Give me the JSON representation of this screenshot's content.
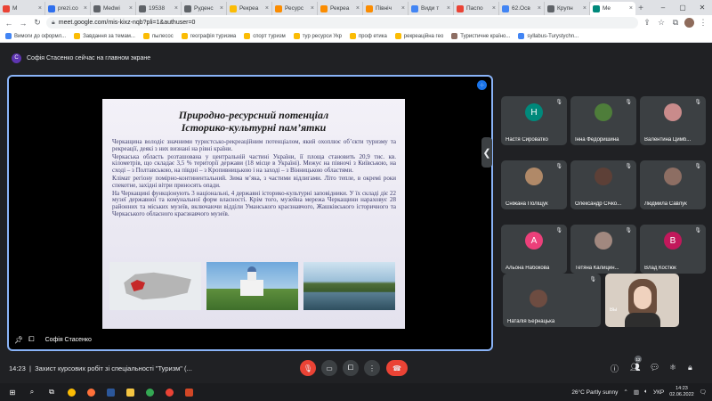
{
  "browser": {
    "tabs": [
      {
        "label": "M",
        "color": "#ea4335"
      },
      {
        "label": "prezi.co",
        "color": "#2f6fed"
      },
      {
        "label": "Medwi",
        "color": "#5f6368"
      },
      {
        "label": "19538",
        "color": "#5f6368"
      },
      {
        "label": "Руденс",
        "color": "#5f6368"
      },
      {
        "label": "Рекреа",
        "color": "#fbbc04"
      },
      {
        "label": "Ресурс",
        "color": "#fb8c00"
      },
      {
        "label": "Рекреа",
        "color": "#fb8c00"
      },
      {
        "label": "Північ",
        "color": "#fb8c00"
      },
      {
        "label": "Види т",
        "color": "#4285f4"
      },
      {
        "label": "Паспо",
        "color": "#ea4335"
      },
      {
        "label": "62.Осв",
        "color": "#4285f4"
      },
      {
        "label": "Крупн",
        "color": "#5f6368"
      },
      {
        "label": "Me",
        "color": "#00897b",
        "active": true
      }
    ],
    "url": "meet.google.com/mis-kixz-nqb?pli=1&authuser=0",
    "bookmarks": [
      {
        "label": "Вимоги до оформл...",
        "color": "#4285f4"
      },
      {
        "label": "Завдання за темам...",
        "color": "#fbbc04"
      },
      {
        "label": "пылесос",
        "color": "#fbbc04"
      },
      {
        "label": "географія туризма",
        "color": "#fbbc04"
      },
      {
        "label": "спорт туризм",
        "color": "#fbbc04"
      },
      {
        "label": "тур ресурси Укр",
        "color": "#fbbc04"
      },
      {
        "label": "проф етика",
        "color": "#fbbc04"
      },
      {
        "label": "рекреаційна гео",
        "color": "#fbbc04"
      },
      {
        "label": "Туристичне країно...",
        "color": "#8d6e63"
      },
      {
        "label": "syllabus-Turystychn...",
        "color": "#4285f4"
      }
    ]
  },
  "meet": {
    "presenting_initial": "С",
    "presenting_text": "Софія Стасенко сейчас на главном экране",
    "presenter_name": "Софія Стасенко",
    "slide": {
      "title_line1": "Природно-ресурсний потенціал",
      "title_line2": "Історико-культурні пам’ятки",
      "para1": "Черкащина володіє значними туристсько-рекреаційним потенціалом, який охоплює об’єкти туризму та рекреації, деякі з них визнані на рівні країни.",
      "para2": "Черкаська область розташована у центральній частині України, її площа становить 20,9 тис. кв. кілометрів, що складає 3,5 % території держави (18 місце в Україні). Межує на півночі з Київською, на сході – з Полтавською, на півдні – з Кропивницькою і на заході – з Вінницькою областями.",
      "para3": "Клімат регіону помірно-континентальний. Зима м’яка, з частими відлигами. Літо тепле, в окремі роки спекотне, західні вітри приносять опади.",
      "para4": "На Черкащині функціонують 3 національні, 4 державні історико-культурні заповідники. У їх складі діє 22 музеї державної та комунальної форм власності. Крім того, музейна мережа Черкащини нараховує 28 районних та міських музеїв, включаючи відділи Уманського краєзнавчого, Жашківського історичного та Черкаського обласного краєзнавчого музеїв."
    },
    "participants": [
      {
        "name": "Настя Сироватко",
        "initial": "Н",
        "color": "#00897b"
      },
      {
        "name": "Інна Федоришина",
        "initial": "",
        "color": "#4e7d3a"
      },
      {
        "name": "Валентина Цимб...",
        "initial": "",
        "color": "#c98b8b"
      },
      {
        "name": "Сніжана Поліщук",
        "initial": "",
        "color": "#b08968"
      },
      {
        "name": "Олександр Січко...",
        "initial": "",
        "color": "#5d4037"
      },
      {
        "name": "Людмила Савлук",
        "initial": "",
        "color": "#8d6e63"
      },
      {
        "name": "Альона Набокова",
        "initial": "А",
        "color": "#ec407a"
      },
      {
        "name": "Тетяна Калицин...",
        "initial": "",
        "color": "#a1887f"
      },
      {
        "name": "Влад Костюк",
        "initial": "В",
        "color": "#c2185b"
      },
      {
        "name": "Наталія Бернацька",
        "initial": "",
        "color": "#6d4c41"
      }
    ],
    "self_label": "Вы",
    "time": "14:23",
    "meeting_title": "Захист курсових робіт зі спеціальності \"Туризм\" (...",
    "participant_count": "12"
  },
  "taskbar": {
    "weather": "26°C  Partly sunny",
    "lang": "УКР",
    "time": "14:23",
    "date": "02.06.2022"
  }
}
